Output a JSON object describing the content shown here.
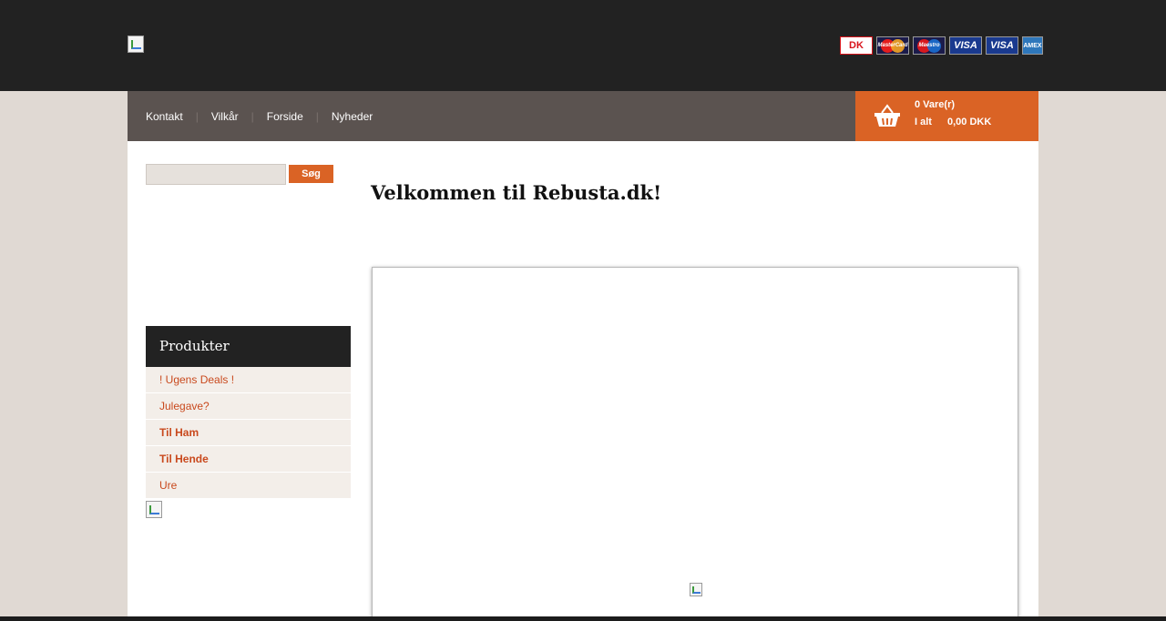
{
  "nav": {
    "items": [
      "Kontakt",
      "Vilkår",
      "Forside",
      "Nyheder"
    ],
    "separator": "|"
  },
  "payment_cards": [
    {
      "name": "dankort-icon",
      "label": "DK"
    },
    {
      "name": "mastercard-icon",
      "label": "MasterCard"
    },
    {
      "name": "maestro-icon",
      "label": "Maestro"
    },
    {
      "name": "visa-icon",
      "label": "VISA"
    },
    {
      "name": "visa-electron-icon",
      "label": "VISA"
    },
    {
      "name": "amex-icon",
      "label": "AMEX"
    }
  ],
  "cart": {
    "count": "0 Vare(r)",
    "total_label": "I alt",
    "total": "0,00 DKK"
  },
  "search": {
    "button": "Søg",
    "value": ""
  },
  "sidebar": {
    "title": "Produkter",
    "categories": [
      {
        "label": "! Ugens Deals !",
        "bold": false
      },
      {
        "label": "Julegave?",
        "bold": false
      },
      {
        "label": "Til Ham",
        "bold": true
      },
      {
        "label": "Til Hende",
        "bold": true
      },
      {
        "label": "Ure",
        "bold": false
      }
    ]
  },
  "main": {
    "title": "Velkommen til Rebusta.dk!"
  },
  "colors": {
    "accent": "#da6325",
    "topbar": "#222222",
    "navbar": "#5b5350",
    "link": "#c9491d"
  }
}
